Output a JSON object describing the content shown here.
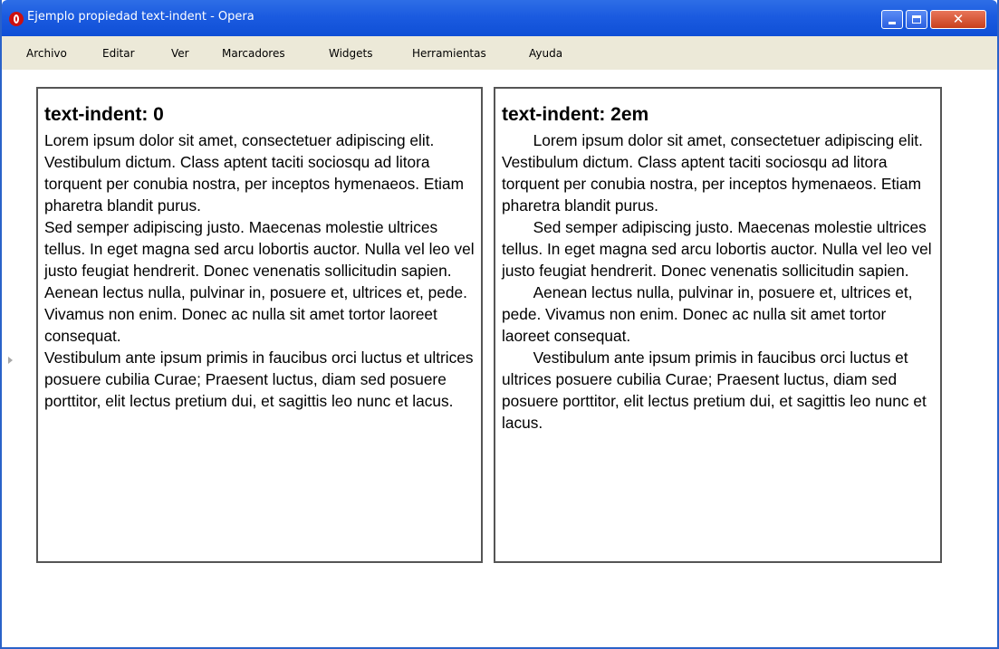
{
  "window": {
    "title": "Ejemplo propiedad text-indent - Opera",
    "controls": {
      "minimize_icon": "minimize-icon",
      "maximize_icon": "maximize-icon",
      "close_label": "✕"
    },
    "accent_color": "#1b5be0"
  },
  "menu": [
    "Archivo",
    "Editar",
    "Ver",
    "Marcadores",
    "Widgets",
    "Herramientas",
    "Ayuda"
  ],
  "boxes": [
    {
      "heading": "text-indent: 0",
      "paragraphs": [
        "Lorem ipsum dolor sit amet, consectetuer adipiscing elit. Vestibulum dictum. Class aptent taciti sociosqu ad litora torquent per conubia nostra, per inceptos hymenaeos. Etiam pharetra blandit purus.",
        "Sed semper adipiscing justo. Maecenas molestie ultrices tellus. In eget magna sed arcu lobortis auctor. Nulla vel leo vel justo feugiat hendrerit. Donec venenatis sollicitudin sapien.",
        "Aenean lectus nulla, pulvinar in, posuere et, ultrices et, pede. Vivamus non enim. Donec ac nulla sit amet tortor laoreet consequat.",
        "Vestibulum ante ipsum primis in faucibus orci luctus et ultrices posuere cubilia Curae; Praesent luctus, diam sed posuere porttitor, elit lectus pretium dui, et sagittis leo nunc et lacus."
      ]
    },
    {
      "heading": "text-indent: 2em",
      "paragraphs": [
        "Lorem ipsum dolor sit amet, consectetuer adipiscing elit. Vestibulum dictum. Class aptent taciti sociosqu ad litora torquent per conubia nostra, per inceptos hymenaeos. Etiam pharetra blandit purus.",
        "Sed semper adipiscing justo. Maecenas molestie ultrices tellus. In eget magna sed arcu lobortis auctor. Nulla vel leo vel justo feugiat hendrerit. Donec venenatis sollicitudin sapien.",
        "Aenean lectus nulla, pulvinar in, posuere et, ultrices et, pede. Vivamus non enim. Donec ac nulla sit amet tortor laoreet consequat.",
        "Vestibulum ante ipsum primis in faucibus orci luctus et ultrices posuere cubilia Curae; Praesent luctus, diam sed posuere porttitor, elit lectus pretium dui, et sagittis leo nunc et lacus."
      ]
    }
  ]
}
